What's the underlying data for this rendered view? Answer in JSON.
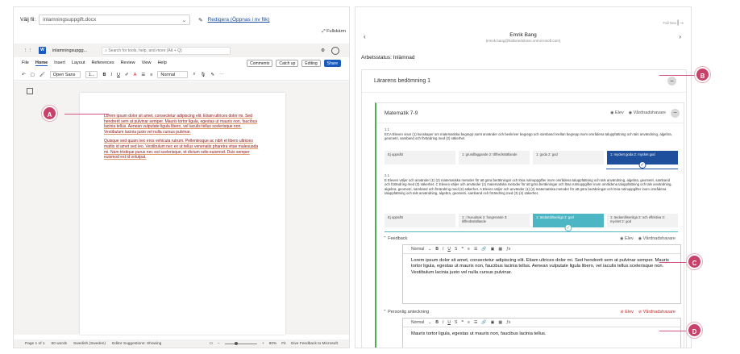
{
  "left": {
    "file_label": "Välj fil:",
    "file_value": "inlamningsuppgift.docx",
    "edit_link": "Redigera (Öppnas i nv flik)",
    "fullscreen": "Fullskärm",
    "word": {
      "doc_name": "inlamningsupgg...",
      "search_placeholder": "Search for tools, help, and more (Alt + Q)",
      "menu": [
        "File",
        "Home",
        "Insert",
        "Layout",
        "References",
        "Review",
        "View",
        "Help"
      ],
      "comments": "Comments",
      "catch_up": "Catch up",
      "editing": "Editing",
      "share": "Share",
      "font": "Open Sans",
      "size": "1...",
      "style": "Normal",
      "doc_paragraphs": [
        "Lorem ipsum dolor sit amet, consectetur adipiscing elit. Etiam ultrices dolor mi. Sed hendrerit sem at pulvinar semper. Mauris tortor ligula, egestas ut mauris non, faucibus lacinia tellus. Aenean vulputate ligula libero, vel iaculis tellus scelerisque non. Vestibulum lacinia justo vel nulla cursus pulvinar.",
        "Quisque sed quam nec eros vehicula rutrum. Pellentesque ac nibh et libero ultricies mattis id amet sed leo. Vestibulum nec ex ut tellus venenatis pharetra vitae malesuada mi. Nam tristique purus nec est scelerisque, et dictum odio euismod. Duis semper euismod est id volutpat."
      ],
      "status": {
        "page": "Page 1 of 1",
        "words": "80 words",
        "lang": "Swedish (Sweden)",
        "editor": "Editor Suggestions: Showing",
        "zoom": "90%",
        "fit": "Fit",
        "feedback": "Give Feedback to Microsoft"
      }
    }
  },
  "right": {
    "nav_label": "Fall Nav",
    "student_name": "Emrik Bang",
    "student_email": "(emrik.bang@hallonedsboss.onmicrosoft.com)",
    "status_label": "Arbetsstatus:",
    "status_value": "Inlämnad",
    "assessment_title": "Lärarens bedömning 1",
    "subject": "Matematik 7-9",
    "elev": "Elev",
    "vardnad": "Vårdnadshavare",
    "criteria": [
      {
        "num": "1.1",
        "text": "ECA Eleven visar (1) kunskaper om matematiska begrepp samt använder och beskriver begrepp och samband mellan begrepp inom områdena taluppfattning och tals användning, algebra, geometri, samband och förändring med (2) säkerhet.",
        "levels": [
          "Ej uppnått",
          "1: grundläggande 2: tillfredsställande",
          "1: goda 2: god",
          "1: mycket goda 2: mycket god"
        ],
        "selected": 3
      },
      {
        "num": "2.1",
        "text": "E Eleven väljer och använder (1) (2) matematiska metoder för att göra beräkningar och lösa rutinuppgifter inom områdena taluppfattning och tals användning, algebra, geometri, samband och förändring med (3) säkerhet. C Eleven väljer och använder (1) matematiska metoder för att göra beräkningar och lösa rutinuppgifter inom områdena taluppfattning och tals användning, algebra, geometri, samband och förändring med (2) säkerhet. A Eleven väljer och använder (1) (2) matematiska metoder för att göra beräkningar och lösa rutinuppgifter inom områdena taluppfattning och tals användning, algebra, geometri, samband och förändring med (3) (4) säkerhet.",
        "levels": [
          "Ej uppnått",
          "1: i huvudsak 2: fungerande 3: tillfredsställande",
          "1: ändamålsenliga 2: god",
          "1: ändamålsenliga 2: och effektiva 3: mycket 2: god"
        ],
        "selected": 2
      }
    ],
    "feedback_label": "Feedback",
    "feedback_text": "Lorem ipsum dolor sit amet, consectetur adipiscing elit. Etiam ultrices dolor mi. Sed hendrerit sem at pulvinar semper. Mauris tortor ligula, egestas ut mauris non, faucibus lacinia tellus. Aenean vulputate ligula libero, vel iaculis tellus scelerisque non. Vestibulum lacinia justo vel nulla cursus pulvinar.",
    "personal_label": "Personlig anteckning",
    "personal_text": "Mauris tortor ligula, egestas ut mauris non, faucibus lacinia tellus.",
    "editor_style": "Normal"
  },
  "callouts": [
    "A",
    "B",
    "C",
    "D"
  ],
  "colors": {
    "accent": "#1e4f9c",
    "teal": "#4db6c5",
    "callout": "#c8416b",
    "word_blue": "#185abd"
  }
}
